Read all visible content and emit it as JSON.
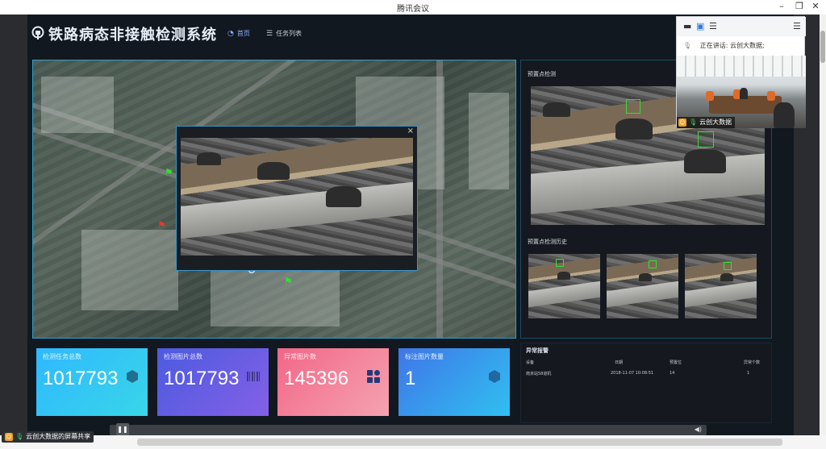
{
  "window": {
    "title": "腾讯会议"
  },
  "dashboard": {
    "system_title": "铁路病态非接触检测系统",
    "nav": [
      {
        "label": "首页"
      },
      {
        "label": "任务列表"
      }
    ],
    "popup_close": "×",
    "right_panel": {
      "preset_title": "预置点检测",
      "history_title": "预置点检测历史"
    },
    "stats": [
      {
        "label": "检测任务总数",
        "value": "1017793",
        "color_from": "#2fb8ff",
        "color_to": "#38d6e8",
        "icon": "hexagon-icon"
      },
      {
        "label": "检测图片总数",
        "value": "1017793",
        "color_from": "#4b5be0",
        "color_to": "#8460e6",
        "icon": "barcode-icon"
      },
      {
        "label": "异常图片数",
        "value": "145396",
        "color_from": "#f26688",
        "color_to": "#f5a3b0",
        "icon": "grid-icon"
      },
      {
        "label": "标注图片数量",
        "value": "1",
        "color_from": "#3f76e8",
        "color_to": "#30c0f0",
        "icon": "hexagon-icon"
      }
    ],
    "alarm": {
      "title": "异常报警",
      "columns": [
        "设备",
        "日期",
        "预置位",
        "异常个数"
      ],
      "rows": [
        {
          "device": "南京站58道机",
          "date": "2018-11-07 10:08:51",
          "preset": "14",
          "count": "1"
        }
      ]
    }
  },
  "meeting": {
    "speaking_label": "正在讲话:",
    "speaker": "云创大数据;",
    "video_name": "云创大数据"
  },
  "share_label": "云创大数据的屏幕共享"
}
